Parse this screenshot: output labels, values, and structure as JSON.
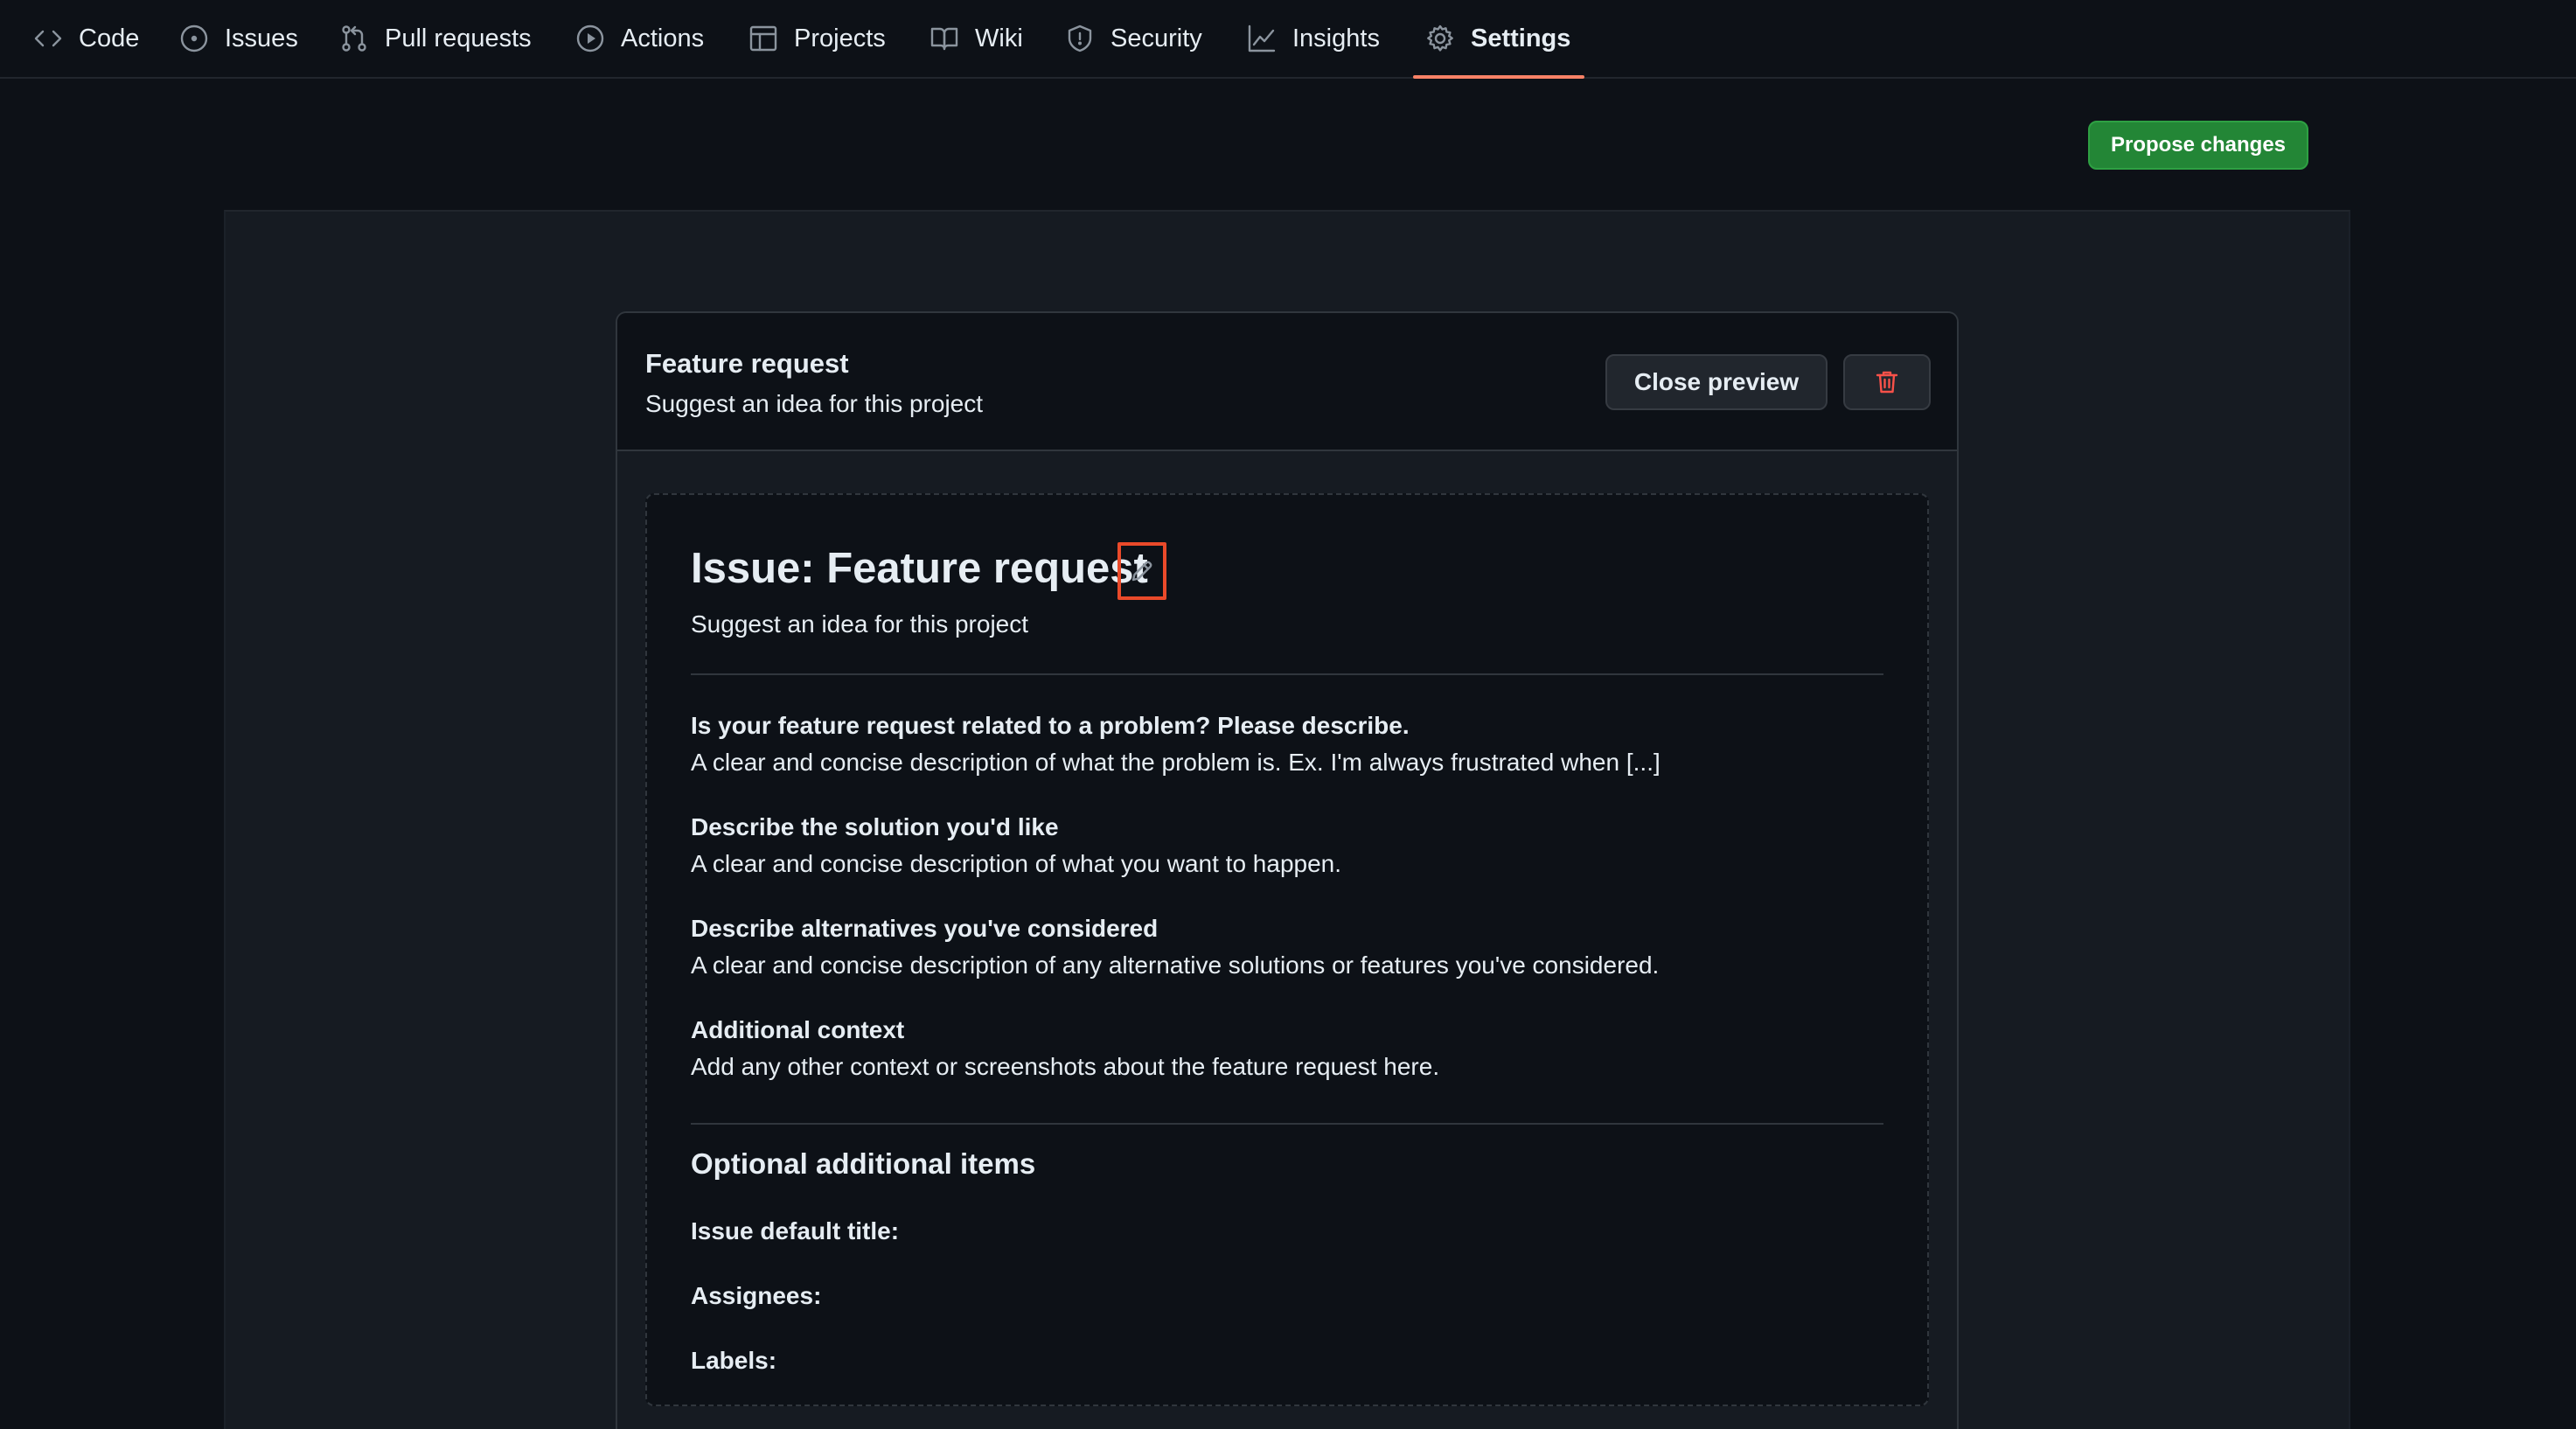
{
  "nav": {
    "tabs": [
      {
        "label": "Code",
        "icon": "code-icon"
      },
      {
        "label": "Issues",
        "icon": "issue-opened-icon"
      },
      {
        "label": "Pull requests",
        "icon": "git-pull-request-icon"
      },
      {
        "label": "Actions",
        "icon": "play-icon"
      },
      {
        "label": "Projects",
        "icon": "table-icon"
      },
      {
        "label": "Wiki",
        "icon": "book-icon"
      },
      {
        "label": "Security",
        "icon": "shield-icon"
      },
      {
        "label": "Insights",
        "icon": "graph-icon"
      },
      {
        "label": "Settings",
        "icon": "gear-icon"
      }
    ],
    "active_tab": "Settings",
    "active_color": "#f78166"
  },
  "toolbar": {
    "propose_label": "Propose changes",
    "propose_color": "#238636"
  },
  "template_card": {
    "title": "Feature request",
    "subtitle": "Suggest an idea for this project",
    "close_preview_label": "Close preview",
    "delete_icon": "trash-icon",
    "delete_color": "#f85149"
  },
  "preview": {
    "issue_title": "Issue: Feature request",
    "edit_icon": "pencil-icon",
    "highlight_color": "#ea4a2a",
    "issue_description": "Suggest an idea for this project",
    "sections": [
      {
        "label": "Is your feature request related to a problem? Please describe.",
        "text": "A clear and concise description of what the problem is. Ex. I'm always frustrated when [...]"
      },
      {
        "label": "Describe the solution you'd like",
        "text": "A clear and concise description of what you want to happen."
      },
      {
        "label": "Describe alternatives you've considered",
        "text": "A clear and concise description of any alternative solutions or features you've considered."
      },
      {
        "label": "Additional context",
        "text": "Add any other context or screenshots about the feature request here."
      }
    ],
    "optional": {
      "heading": "Optional additional items",
      "default_title_label": "Issue default title:",
      "assignees_label": "Assignees:",
      "labels_label": "Labels:"
    }
  }
}
